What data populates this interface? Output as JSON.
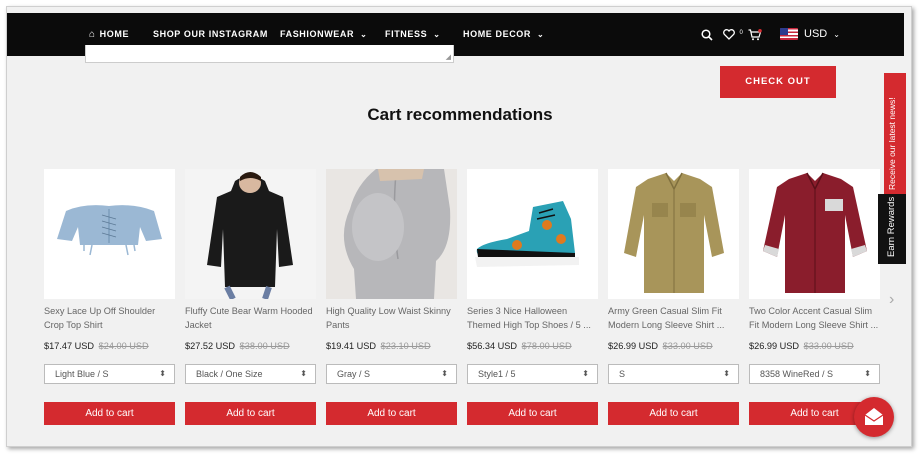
{
  "nav": {
    "items": [
      {
        "label": "HOME"
      },
      {
        "label": "SHOP OUR INSTAGRAM"
      },
      {
        "label": "FASHIONWEAR"
      },
      {
        "label": "FITNESS"
      },
      {
        "label": "HOME DECOR"
      }
    ],
    "wishlist_count": "0",
    "currency": "USD"
  },
  "checkout_label": "CHECK OUT",
  "section_title": "Cart recommendations",
  "products": [
    {
      "name": "Sexy Lace Up Off Shoulder Crop Top Shirt",
      "price": "$17.47 USD",
      "old_price": "$24.00 USD",
      "variant": "Light Blue / S",
      "add_label": "Add to cart"
    },
    {
      "name": "Fluffy Cute Bear Warm Hooded Jacket",
      "price": "$27.52 USD",
      "old_price": "$38.00 USD",
      "variant": "Black / One Size",
      "add_label": "Add to cart"
    },
    {
      "name": "High Quality Low Waist Skinny Pants",
      "price": "$19.41 USD",
      "old_price": "$23.10 USD",
      "variant": "Gray / S",
      "add_label": "Add to cart"
    },
    {
      "name": "Series 3 Nice Halloween Themed High Top Shoes / 5 ...",
      "price": "$56.34 USD",
      "old_price": "$78.00 USD",
      "variant": "Style1 / 5",
      "add_label": "Add to cart"
    },
    {
      "name": "Army Green Casual Slim Fit Modern Long Sleeve Shirt ...",
      "price": "$26.99 USD",
      "old_price": "$33.00 USD",
      "variant": "S",
      "add_label": "Add to cart"
    },
    {
      "name": "Two Color Accent Casual Slim Fit Modern Long Sleeve Shirt ...",
      "price": "$26.99 USD",
      "old_price": "$33.00 USD",
      "variant": "8358 WineRed / S",
      "add_label": "Add to cart"
    }
  ],
  "side_tabs": {
    "newsletter": "Receive our latest news!",
    "rewards": "Earn Rewards"
  },
  "colors": {
    "accent": "#d42a2f",
    "nav_bg": "#0b0b0b"
  }
}
